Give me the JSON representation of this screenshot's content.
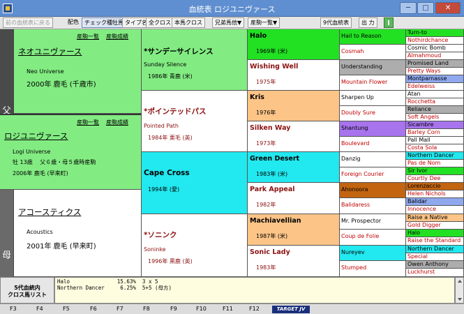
{
  "window": {
    "title": "血統表 ロジユニヴァース",
    "minimize": "─",
    "maximize": "□",
    "close": "✕"
  },
  "toolbar": {
    "prev_button": "前の血統表に戻る",
    "color_label": "配色",
    "check_sire": "チェック種牡馬",
    "type_name": "タイプ名",
    "all_cross": "全クロス",
    "this_horse_cross": "本馬クロス",
    "siblings": "兄弟馬他▼",
    "progeny": "産駒一覧▼",
    "nine_gen": "9代血統表",
    "print": "出 力"
  },
  "common": {
    "progeny_list": "産駒一覧",
    "progeny_results": "産駒成績"
  },
  "side": {
    "father": "父",
    "mother": "母"
  },
  "gen1": {
    "sire": {
      "name": "ネオユニヴァース",
      "en": "Neo Universe",
      "info": "2000年 鹿毛 (千歳市)"
    },
    "subject": {
      "name": "ロジユニヴァース",
      "en": "Logi Universe",
      "info1": "牡 13歳　 父６歳・母５歳時産駒",
      "info2": "2006年 鹿毛 (早来町)"
    },
    "dam": {
      "name": "アコースティクス",
      "en": "Acoustics",
      "info": "2001年 鹿毛 (早来町)"
    }
  },
  "gen2": [
    {
      "name": "*サンデーサイレンス",
      "en": "Sunday Silence",
      "info": "1986年 青鹿 (米)"
    },
    {
      "name": "*ポインテッドパス",
      "en": "Pointed Path",
      "info": "1984年 栗毛 (英)"
    },
    {
      "name": "Cape Cross",
      "info": "1994年 (愛)"
    },
    {
      "name": "*ソニンク",
      "en": "Soninke",
      "info": "1996年 黒鹿 (英)"
    }
  ],
  "gen3": [
    {
      "name": "Halo",
      "year": "1969年 (米)"
    },
    {
      "name": "Wishing Well",
      "year": "1975年"
    },
    {
      "name": "Kris",
      "year": "1976年"
    },
    {
      "name": "Silken Way",
      "year": "1973年"
    },
    {
      "name": "Green Desert",
      "year": "1983年 (米)"
    },
    {
      "name": "Park Appeal",
      "year": "1982年"
    },
    {
      "name": "Machiavellian",
      "year": "1987年 (米)"
    },
    {
      "name": "Sonic Lady",
      "year": "1983年"
    }
  ],
  "gen4": [
    "Hail to Reason",
    "Cosmah",
    "Understanding",
    "Mountain Flower",
    "Sharpen Up",
    "Doubly Sure",
    "Shantung",
    "Boulevard",
    "Danzig",
    "Foreign Courier",
    "Ahonoora",
    "Balidaress",
    "Mr. Prospector",
    "Coup de Folie",
    "Nureyev",
    "Stumped"
  ],
  "gen5": [
    "Turn-to",
    "Nothirdchance",
    "Cosmic Bomb",
    "Almahmoud",
    "Promised Land",
    "Pretty Ways",
    "Montparnasse",
    "Edelweiss",
    "Atan",
    "Rocchetta",
    "Reliance",
    "Soft Angels",
    "Sicambre",
    "Barley Corn",
    "Pall Mall",
    "Costa Sola",
    "Northern Dancer",
    "Pas de Nom",
    "Sir Ivor",
    "Courtly Dee",
    "Lorenzaccio",
    "Helen Nichols",
    "Balidar",
    "Innocence",
    "Raise a Native",
    "Gold Digger",
    "Halo",
    "Raise the Standard",
    "Northern Dancer",
    "Special",
    "Owen Anthony",
    "Luckhurst"
  ],
  "cross": {
    "label1": "5代血統内",
    "label2": "クロス馬リスト",
    "lines": [
      "Halo               15.63%  3 x 5",
      "Northern Dancer     6.25%  5+5 (母方)"
    ]
  },
  "fkeys": [
    "F3",
    "F4",
    "F5",
    "F6",
    "F7",
    "F8",
    "F9",
    "F10",
    "F11",
    "F12"
  ],
  "brand": "TARGET JV",
  "colors": {
    "green": "#82ec82",
    "bright_green": "#22e022",
    "cyan": "#22e8ef",
    "peach": "#fcc487",
    "gray": "#adadad",
    "purple": "#a774ed",
    "blue": "#8fa8ee",
    "brown": "#c26410"
  }
}
